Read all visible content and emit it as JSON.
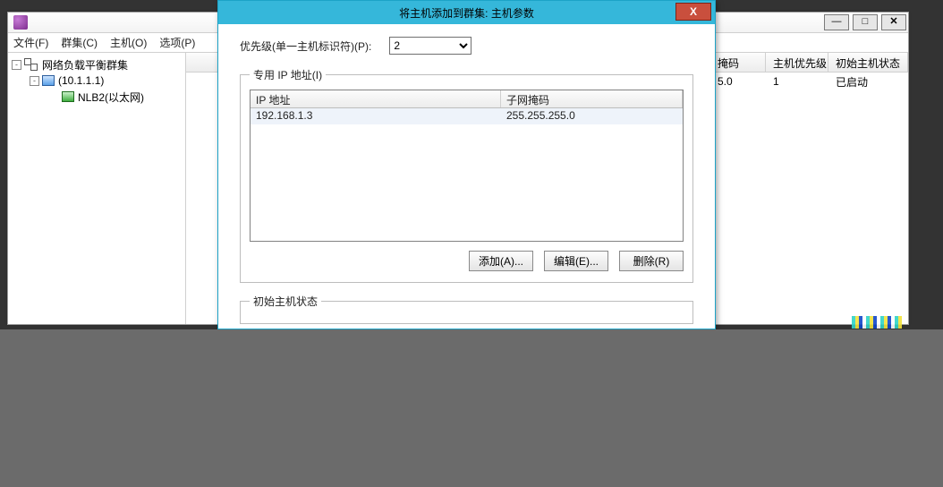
{
  "main": {
    "menubar": {
      "file": "文件(F)",
      "cluster": "群集(C)",
      "host": "主机(O)",
      "options": "选项(P)"
    },
    "tree": {
      "root": "网络负载平衡群集",
      "cluster": "(10.1.1.1)",
      "host": "NLB2(以太网)"
    },
    "columns": {
      "mask": "掩码",
      "priority": "主机优先级",
      "state": "初始主机状态"
    },
    "row": {
      "mask": "5.0",
      "priority": "1",
      "state": "已启动"
    }
  },
  "dialog": {
    "title": "将主机添加到群集: 主机参数",
    "priority_label": "优先级(单一主机标识符)(P):",
    "priority_value": "2",
    "fieldset_ip": "专用 IP 地址(I)",
    "ipcols": {
      "ip": "IP 地址",
      "mask": "子网掩码"
    },
    "iprow": {
      "ip": "192.168.1.3",
      "mask": "255.255.255.0"
    },
    "buttons": {
      "add": "添加(A)...",
      "edit": "编辑(E)...",
      "remove": "删除(R)"
    },
    "fieldset_state": "初始主机状态"
  }
}
